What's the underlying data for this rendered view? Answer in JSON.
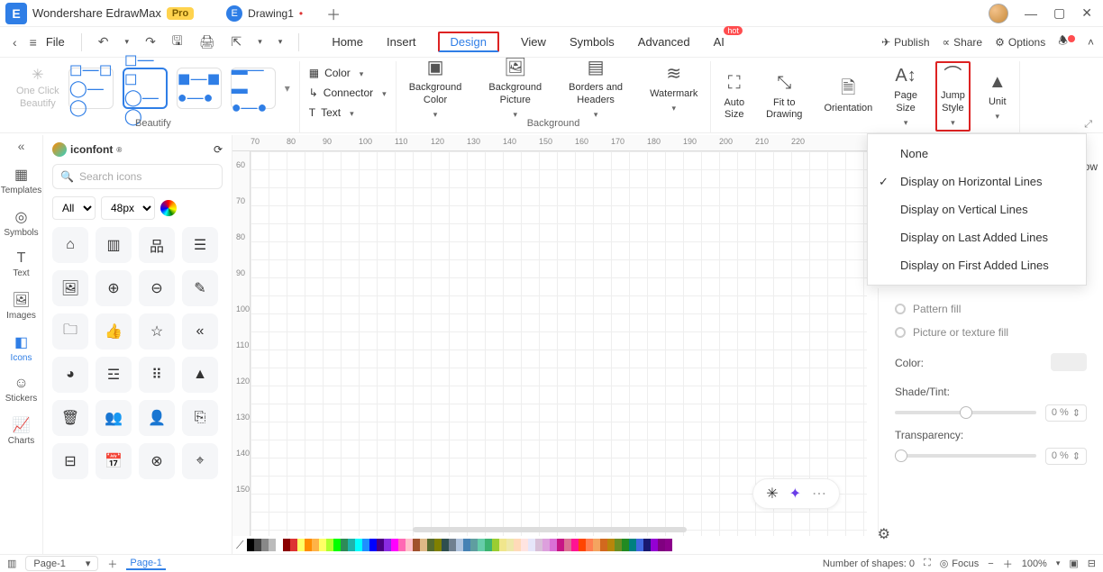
{
  "app": {
    "name": "Wondershare EdrawMax",
    "badge": "Pro"
  },
  "tabs": {
    "doc": "Drawing1"
  },
  "file": {
    "label": "File"
  },
  "menu": {
    "home": "Home",
    "insert": "Insert",
    "design": "Design",
    "view": "View",
    "symbols": "Symbols",
    "advanced": "Advanced",
    "ai": "AI",
    "hot": "hot"
  },
  "topRight": {
    "publish": "Publish",
    "share": "Share",
    "options": "Options"
  },
  "ribbon": {
    "oneclick": "One Click\nBeautify",
    "beautify": "Beautify",
    "color": "Color",
    "connector": "Connector",
    "text": "Text",
    "bgcolor": "Background\nColor",
    "bgpic": "Background\nPicture",
    "borders": "Borders and\nHeaders",
    "watermark": "Watermark",
    "background": "Background",
    "autosize": "Auto\nSize",
    "fit": "Fit to\nDrawing",
    "orientation": "Orientation",
    "pagesize": "Page\nSize",
    "jump": "Jump\nStyle",
    "unit": "Unit"
  },
  "leftbar": {
    "templates": "Templates",
    "symbols": "Symbols",
    "text": "Text",
    "images": "Images",
    "icons": "Icons",
    "stickers": "Stickers",
    "charts": "Charts"
  },
  "iconpanel": {
    "brand": "iconfont",
    "searchPlaceholder": "Search icons",
    "filterAll": "All",
    "filterSize": "48px"
  },
  "dropdown": {
    "none": "None",
    "horiz": "Display on Horizontal Lines",
    "vert": "Display on Vertical Lines",
    "last": "Display on Last Added Lines",
    "first": "Display on First Added Lines"
  },
  "sidepanel": {
    "shadow": "Shadow",
    "pattern": "Pattern fill",
    "texture": "Picture or texture fill",
    "colorLabel": "Color:",
    "shade": "Shade/Tint:",
    "transparency": "Transparency:",
    "pct0": "0 %"
  },
  "ruler": {
    "h": [
      "70",
      "80",
      "90",
      "100",
      "110",
      "120",
      "130",
      "140",
      "150",
      "160",
      "170",
      "180",
      "190",
      "200",
      "210",
      "220"
    ],
    "v": [
      "60",
      "70",
      "80",
      "90",
      "100",
      "110",
      "120",
      "130",
      "140",
      "150"
    ]
  },
  "status": {
    "pageSel": "Page-1",
    "pageTab": "Page-1",
    "shapes": "Number of shapes: 0",
    "focus": "Focus",
    "zoom": "100%"
  },
  "colors": [
    "#000",
    "#444",
    "#888",
    "#bbb",
    "#fff",
    "#8b0000",
    "#d33",
    "#ff6",
    "#ff8c00",
    "#ffb347",
    "#ffff66",
    "#adff2f",
    "#0f0",
    "#2e8b57",
    "#20b2aa",
    "#0ff",
    "#1e90ff",
    "#00f",
    "#4b0082",
    "#8a2be2",
    "#f0f",
    "#ff69b4",
    "#ffc0cb",
    "#a0522d",
    "#deb887",
    "#556b2f",
    "#808000",
    "#2f4f4f",
    "#708090",
    "#b0c4de",
    "#4682b4",
    "#5f9ea0",
    "#66cdaa",
    "#3cb371",
    "#9acd32",
    "#f0e68c",
    "#eee8aa",
    "#ffdab9",
    "#ffe4e1",
    "#e6e6fa",
    "#d8bfd8",
    "#dda0dd",
    "#da70d6",
    "#c71585",
    "#db7093",
    "#ff1493",
    "#ff4500",
    "#ff7f50",
    "#f4a460",
    "#d2691e",
    "#b8860b",
    "#6b8e23",
    "#228b22",
    "#008080",
    "#4169e1",
    "#191970",
    "#9400d3",
    "#800080",
    "#8b008b"
  ]
}
